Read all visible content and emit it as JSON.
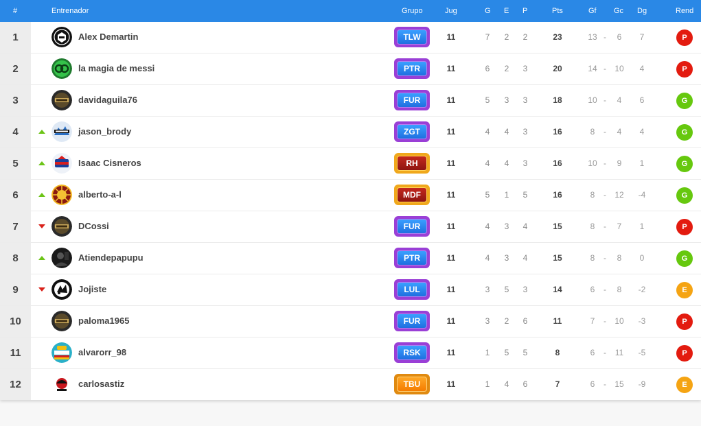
{
  "header": {
    "pos": "#",
    "coach": "Entrenador",
    "group": "Grupo",
    "played": "Jug",
    "won": "G",
    "drawn": "E",
    "lost": "P",
    "points": "Pts",
    "gf": "Gf",
    "gc": "Gc",
    "gd": "Dg",
    "rend": "Rend"
  },
  "colors": {
    "header_bg": "#2a88e6",
    "rend_P": "#e31b0f",
    "rend_G": "#66c80e",
    "rend_E": "#f5a413",
    "trend_up": "#6cc417",
    "trend_down": "#d9211a"
  },
  "rows": [
    {
      "pos": "1",
      "trend": "none",
      "avatar": "dark-crest-icon",
      "coach": "Alex Demartin",
      "group": "TLW",
      "group_style": "purple",
      "jug": "11",
      "g": "7",
      "e": "2",
      "p": "2",
      "pts": "23",
      "gf": "13",
      "dash": "-",
      "gc": "6",
      "dg": "7",
      "rend": "P"
    },
    {
      "pos": "2",
      "trend": "none",
      "avatar": "green-monogram-icon",
      "coach": "la magia de messi",
      "group": "PTR",
      "group_style": "purple",
      "jug": "11",
      "g": "6",
      "e": "2",
      "p": "3",
      "pts": "20",
      "gf": "14",
      "dash": "-",
      "gc": "10",
      "dg": "4",
      "rend": "P"
    },
    {
      "pos": "3",
      "trend": "none",
      "avatar": "furia-crest-icon",
      "coach": "davidaguila76",
      "group": "FUR",
      "group_style": "purple",
      "jug": "11",
      "g": "5",
      "e": "3",
      "p": "3",
      "pts": "18",
      "gf": "10",
      "dash": "-",
      "gc": "4",
      "dg": "6",
      "rend": "G"
    },
    {
      "pos": "4",
      "trend": "up",
      "avatar": "blue-crest-icon",
      "coach": "jason_brody",
      "group": "ZGT",
      "group_style": "purple",
      "jug": "11",
      "g": "4",
      "e": "4",
      "p": "3",
      "pts": "16",
      "gf": "8",
      "dash": "-",
      "gc": "4",
      "dg": "4",
      "rend": "G"
    },
    {
      "pos": "5",
      "trend": "up",
      "avatar": "red-blue-crest-icon",
      "coach": "Isaac Cisneros",
      "group": "RH",
      "group_style": "gold",
      "jug": "11",
      "g": "4",
      "e": "4",
      "p": "3",
      "pts": "16",
      "gf": "10",
      "dash": "-",
      "gc": "9",
      "dg": "1",
      "rend": "G"
    },
    {
      "pos": "6",
      "trend": "up",
      "avatar": "sunburst-crest-icon",
      "coach": "alberto-a-l",
      "group": "MDF",
      "group_style": "gold",
      "jug": "11",
      "g": "5",
      "e": "1",
      "p": "5",
      "pts": "16",
      "gf": "8",
      "dash": "-",
      "gc": "12",
      "dg": "-4",
      "rend": "G"
    },
    {
      "pos": "7",
      "trend": "down",
      "avatar": "furia-crest-icon",
      "coach": "DCossi",
      "group": "FUR",
      "group_style": "purple",
      "jug": "11",
      "g": "4",
      "e": "3",
      "p": "4",
      "pts": "15",
      "gf": "8",
      "dash": "-",
      "gc": "7",
      "dg": "1",
      "rend": "P"
    },
    {
      "pos": "8",
      "trend": "up",
      "avatar": "dark-photo-icon",
      "coach": "Atiendepapupu",
      "group": "PTR",
      "group_style": "purple",
      "jug": "11",
      "g": "4",
      "e": "3",
      "p": "4",
      "pts": "15",
      "gf": "8",
      "dash": "-",
      "gc": "8",
      "dg": "0",
      "rend": "G"
    },
    {
      "pos": "9",
      "trend": "down",
      "avatar": "black-white-crest-icon",
      "coach": "Jojiste",
      "group": "LUL",
      "group_style": "purple",
      "jug": "11",
      "g": "3",
      "e": "5",
      "p": "3",
      "pts": "14",
      "gf": "6",
      "dash": "-",
      "gc": "8",
      "dg": "-2",
      "rend": "E"
    },
    {
      "pos": "10",
      "trend": "none",
      "avatar": "furia-crest-icon",
      "coach": "paloma1965",
      "group": "FUR",
      "group_style": "purple",
      "jug": "11",
      "g": "3",
      "e": "2",
      "p": "6",
      "pts": "11",
      "gf": "7",
      "dash": "-",
      "gc": "10",
      "dg": "-3",
      "rend": "P"
    },
    {
      "pos": "11",
      "trend": "none",
      "avatar": "teal-support-crest-icon",
      "coach": "alvarorr_98",
      "group": "RSK",
      "group_style": "purple",
      "jug": "11",
      "g": "1",
      "e": "5",
      "p": "5",
      "pts": "8",
      "gf": "6",
      "dash": "-",
      "gc": "11",
      "dg": "-5",
      "rend": "P"
    },
    {
      "pos": "12",
      "trend": "none",
      "avatar": "red-ball-crest-icon",
      "coach": "carlosastiz",
      "group": "TBU",
      "group_style": "orange",
      "jug": "11",
      "g": "1",
      "e": "4",
      "p": "6",
      "pts": "7",
      "gf": "6",
      "dash": "-",
      "gc": "15",
      "dg": "-9",
      "rend": "E"
    }
  ]
}
